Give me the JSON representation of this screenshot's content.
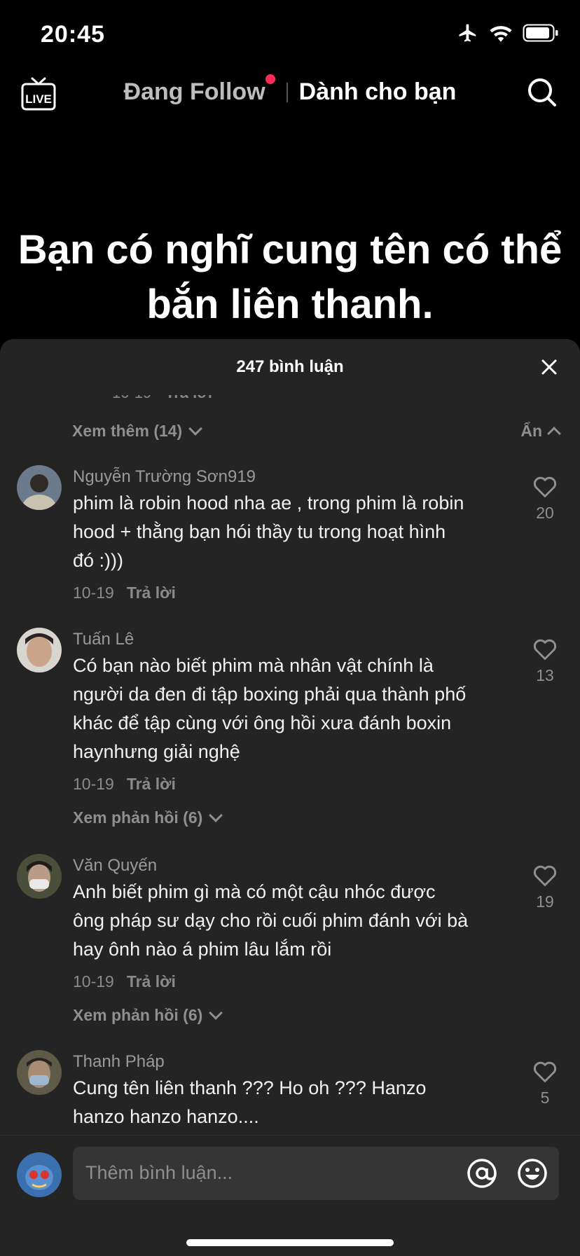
{
  "status_bar": {
    "time": "20:45"
  },
  "top_nav": {
    "live_label": "LIVE",
    "following_tab": "Đang Follow",
    "for_you_tab": "Dành cho bạn"
  },
  "video": {
    "caption_line1": "Bạn có nghĩ cung tên có thể",
    "caption_line2": "bắn liên thanh."
  },
  "comments_sheet": {
    "title": "247 bình luận",
    "cut_meta_date": "10-19",
    "cut_meta_reply": "Trả lời",
    "view_more": "Xem thêm (14)",
    "hide": "Ẩn",
    "comments": [
      {
        "author": "Nguyễn Trường Sơn919",
        "line1": "phim là robin hood nha ae , trong phim là robin",
        "line2": "hood + thằng bạn hói thầy tu trong hoạt hình",
        "line3": "đó :)))",
        "line4": "",
        "date": "10-19",
        "reply": "Trả lời",
        "likes": "20",
        "avatar_color": "#6b7b8c",
        "view_replies": ""
      },
      {
        "author": "Tuấn Lê",
        "line1": "Có bạn nào biết phim mà nhân vật chính là",
        "line2": "người da đen đi tập boxing phải qua thành phố",
        "line3": "khác để tập cùng với ông hồi xưa đánh boxin",
        "line4": "haynhưng giải nghệ",
        "date": "10-19",
        "reply": "Trả lời",
        "likes": "13",
        "avatar_color": "#c9b8a6",
        "view_replies": "Xem phản hồi (6)"
      },
      {
        "author": "Văn Quyến",
        "line1": "Anh biết phim gì mà có một cậu nhóc được",
        "line2": "ông pháp sư dạy cho rồi cuối phim đánh với bà",
        "line3": "hay ônh nào á phim lâu lắm rồi",
        "line4": "",
        "date": "10-19",
        "reply": "Trả lời",
        "likes": "19",
        "avatar_color": "#4a4f3a",
        "view_replies": "Xem phản hồi (6)"
      },
      {
        "author": "Thanh Pháp",
        "line1": "Cung tên liên thanh ??? Ho oh ??? Hanzo",
        "line2": "hanzo hanzo hanzo....",
        "line3": "",
        "line4": "",
        "date": "",
        "reply": "",
        "likes": "5",
        "avatar_color": "#5d5a48",
        "view_replies": ""
      }
    ]
  },
  "composer": {
    "placeholder": "Thêm bình luận..."
  },
  "colors": {
    "accent_dot": "#fe2c55",
    "sheet_bg": "#242424"
  }
}
